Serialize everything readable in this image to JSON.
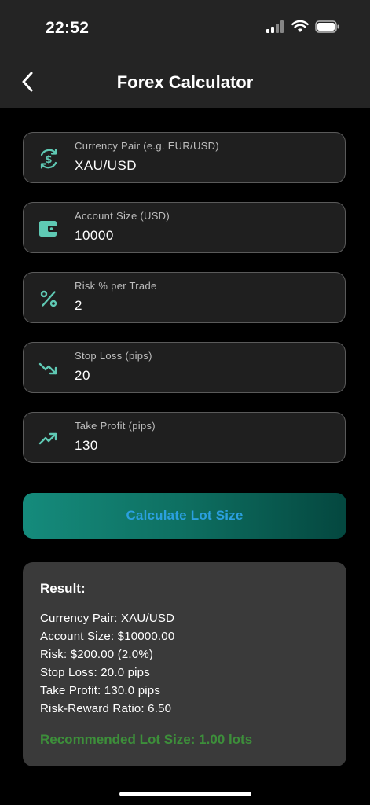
{
  "status_bar": {
    "time": "22:52"
  },
  "header": {
    "title": "Forex Calculator"
  },
  "fields": [
    {
      "label": "Currency Pair (e.g. EUR/USD)",
      "value": "XAU/USD",
      "icon": "currency-exchange-icon"
    },
    {
      "label": "Account Size (USD)",
      "value": "10000",
      "icon": "wallet-icon"
    },
    {
      "label": "Risk % per Trade",
      "value": "2",
      "icon": "percent-icon"
    },
    {
      "label": "Stop Loss (pips)",
      "value": "20",
      "icon": "trending-down-icon"
    },
    {
      "label": "Take Profit (pips)",
      "value": "130",
      "icon": "trending-up-icon"
    }
  ],
  "calculate_button": {
    "label": "Calculate Lot Size"
  },
  "result": {
    "title": "Result:",
    "lines": [
      "Currency Pair: XAU/USD",
      "Account Size: $10000.00",
      "Risk: $200.00 (2.0%)",
      "Stop Loss: 20.0 pips",
      "Take Profit: 130.0 pips",
      "Risk-Reward Ratio: 6.50"
    ],
    "recommendation": "Recommended Lot Size: 1.00 lots"
  },
  "colors": {
    "accent_teal": "#5fc9b4",
    "button_gradient_start": "#158b7c",
    "button_gradient_end": "#04473f",
    "button_text": "#2ba0e0",
    "recommendation_green": "#3d8f3a"
  }
}
